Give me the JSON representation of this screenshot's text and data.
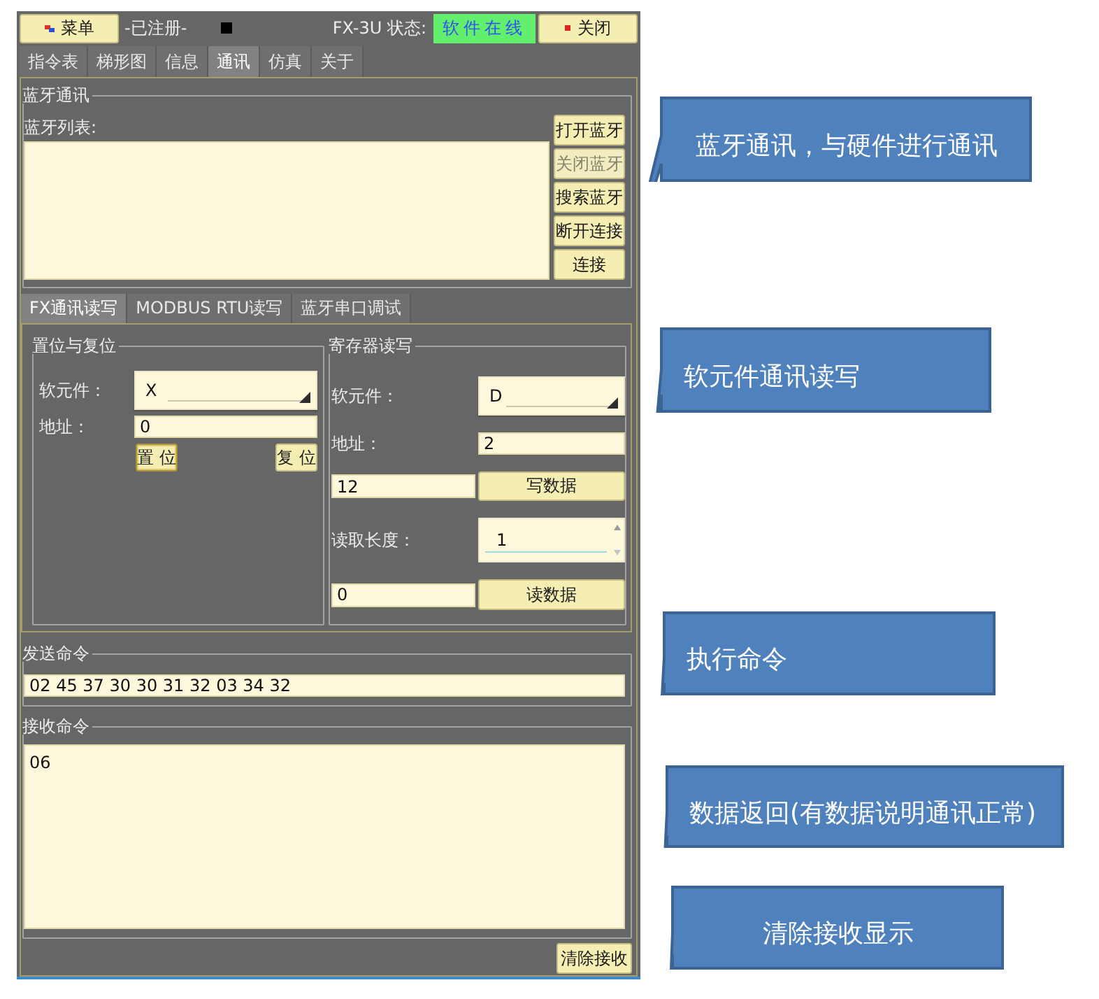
{
  "top_bar": {
    "menu_button": "菜单",
    "registration": "-已注册-",
    "status_label": "FX-3U 状态:",
    "status": "软件在线",
    "close_button": "关闭"
  },
  "tabs": [
    {
      "label": "指令表",
      "selected": false
    },
    {
      "label": "梯形图",
      "selected": false
    },
    {
      "label": "信息",
      "selected": false
    },
    {
      "label": "通讯",
      "selected": true
    },
    {
      "label": "仿真",
      "selected": false
    },
    {
      "label": "关于",
      "selected": false
    }
  ],
  "bluetooth": {
    "title": "蓝牙通讯",
    "list_label": "蓝牙列表:",
    "buttons": [
      {
        "label": "打开蓝牙",
        "disabled": false
      },
      {
        "label": "关闭蓝牙",
        "disabled": true
      },
      {
        "label": "搜索蓝牙",
        "disabled": false
      },
      {
        "label": "断开连接",
        "disabled": false
      },
      {
        "label": "连接",
        "disabled": false
      }
    ]
  },
  "sub_tabs": [
    {
      "label": "FX通讯读写",
      "selected": true
    },
    {
      "label": "MODBUS RTU读写",
      "selected": false
    },
    {
      "label": "蓝牙串口调试",
      "selected": false
    }
  ],
  "set_reset": {
    "title": "置位与复位",
    "device_label": "软元件：",
    "device": "X",
    "address_label": "地址：",
    "address": "0",
    "buttons": [
      {
        "label": "置 位",
        "focused": true
      },
      {
        "label": "复 位",
        "focused": false
      }
    ]
  },
  "register": {
    "title": "寄存器读写",
    "device_label": "软元件：",
    "device": "D",
    "address_label": "地址：",
    "address": "2",
    "write_value": "12",
    "write_button": "写数据",
    "length_label": "读取长度：",
    "length": "1",
    "read_value": "0",
    "read_button": "读数据"
  },
  "send_command": {
    "title": "发送命令",
    "value": "02 45 37 30 30 31 32 03 34 32"
  },
  "receive_command": {
    "title": "接收命令",
    "value": "06"
  },
  "clear_button": "清除接收",
  "callouts": [
    {
      "text": "蓝牙通讯，与硬件进行通讯"
    },
    {
      "text": "软元件通讯读写"
    },
    {
      "text": "执行命令"
    },
    {
      "text": "数据返回(有数据说明通讯正常)"
    },
    {
      "text": "清除接收显示"
    }
  ]
}
